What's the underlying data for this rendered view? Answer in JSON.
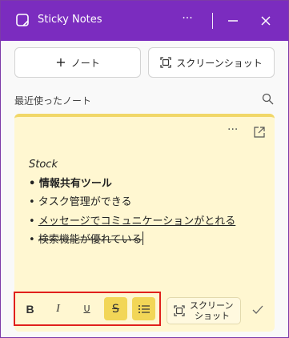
{
  "window": {
    "title": "Sticky Notes"
  },
  "titlebar": {
    "more": "···"
  },
  "toolbar": {
    "new_note_label": "ノート",
    "screenshot_label": "スクリーンショット"
  },
  "recent": {
    "label": "最近使ったノート"
  },
  "note": {
    "more": "···",
    "lines": [
      "Stock",
      "• 情報共有ツール",
      "• タスク管理ができる",
      "メッセージでコミュニケーションがとれる",
      "検索機能が優れている"
    ],
    "bullet": "• "
  },
  "format": {
    "bold": "B",
    "italic": "I",
    "underline": "U",
    "strike": "S",
    "screenshot_line1": "スクリーン",
    "screenshot_line2": "ショット"
  },
  "colors": {
    "titlebar": "#7b2cbf",
    "note_bg": "#fff7d1",
    "highlight": "#f2d657",
    "annotation": "#e0201c"
  }
}
